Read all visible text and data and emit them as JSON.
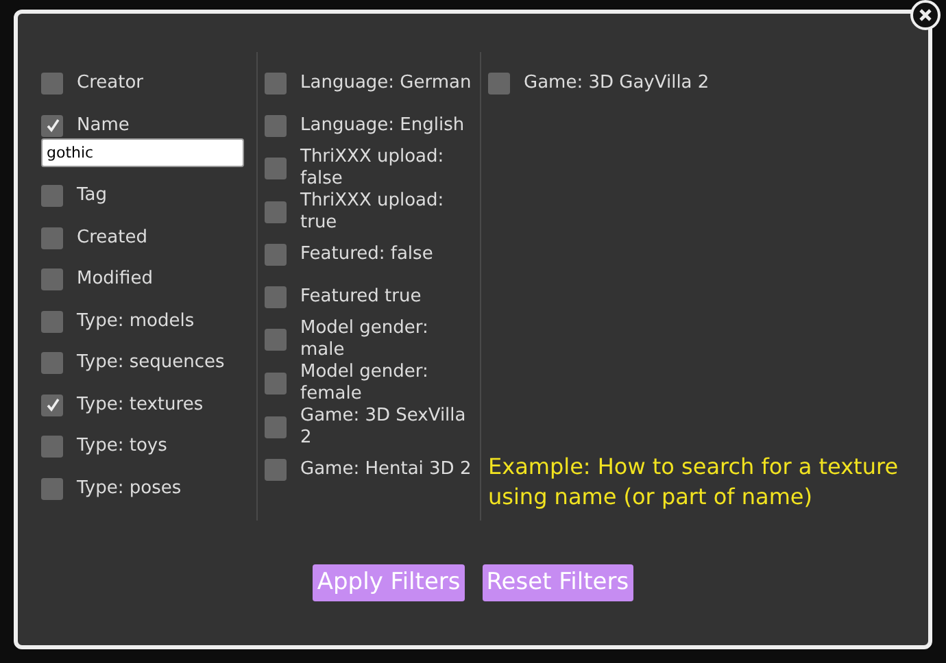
{
  "columns": [
    {
      "items": [
        {
          "label": "Creator",
          "checked": false
        },
        {
          "label": "Name",
          "checked": true,
          "field": {
            "value": "gothic"
          }
        },
        {
          "label": "Tag",
          "checked": false
        },
        {
          "label": "Created",
          "checked": false
        },
        {
          "label": "Modified",
          "checked": false
        },
        {
          "label": "Type: models",
          "checked": false
        },
        {
          "label": "Type: sequences",
          "checked": false
        },
        {
          "label": "Type: textures",
          "checked": true
        },
        {
          "label": "Type: toys",
          "checked": false
        },
        {
          "label": "Type: poses",
          "checked": false
        }
      ]
    },
    {
      "items": [
        {
          "label": "Language: German",
          "checked": false
        },
        {
          "label": "Language: English",
          "checked": false
        },
        {
          "label": "ThriXXX upload: false",
          "checked": false
        },
        {
          "label": "ThriXXX upload: true",
          "checked": false
        },
        {
          "label": "Featured: false",
          "checked": false
        },
        {
          "label": "Featured true",
          "checked": false
        },
        {
          "label": "Model gender: male",
          "checked": false
        },
        {
          "label": "Model gender: female",
          "checked": false
        },
        {
          "label": "Game: 3D SexVilla 2",
          "checked": false
        },
        {
          "label": "Game: Hentai 3D 2",
          "checked": false
        }
      ]
    },
    {
      "items": [
        {
          "label": "Game: 3D GayVilla 2",
          "checked": false
        }
      ]
    }
  ],
  "example": "Example: How to search for a texture using  name (or part of name)",
  "buttons": [
    "Apply Filters",
    "Reset Filters"
  ]
}
